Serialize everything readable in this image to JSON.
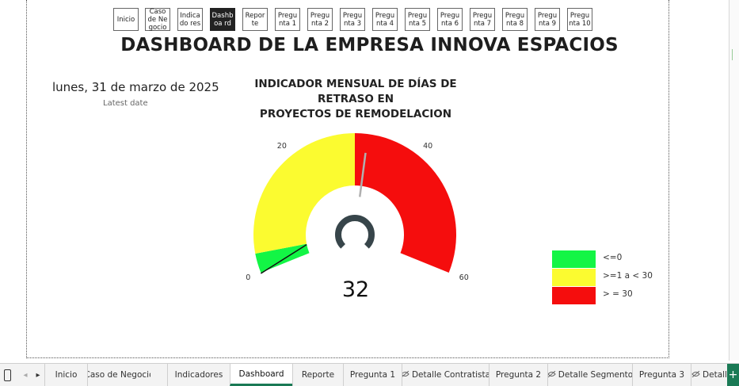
{
  "nav": {
    "buttons": [
      {
        "label": "Inicio"
      },
      {
        "label": "Caso de Negocio"
      },
      {
        "label": "Indicado res"
      },
      {
        "label": "Dashboa rd"
      },
      {
        "label": "Reporte"
      },
      {
        "label": "Pregunta 1"
      },
      {
        "label": "Pregunta 2"
      },
      {
        "label": "Pregunta 3"
      },
      {
        "label": "Pregunta 4"
      },
      {
        "label": "Pregunta 5"
      },
      {
        "label": "Pregunta 6"
      },
      {
        "label": "Pregunta 7"
      },
      {
        "label": "Pregunta 8"
      },
      {
        "label": "Pregunta 9"
      },
      {
        "label": "Pregunta 10"
      }
    ],
    "active_index": 3
  },
  "page": {
    "title": "DASHBOARD DE LA EMPRESA INNOVA ESPACIOS",
    "date": "lunes, 31 de marzo de 2025",
    "date_label": "Latest date"
  },
  "gauge": {
    "title_line1": "INDICADOR MENSUAL DE DÍAS DE RETRASO EN",
    "title_line2": "PROYECTOS DE REMODELACION",
    "min": 0,
    "max": 60,
    "value": 32,
    "value_text": "32",
    "ticks": [
      "0",
      "20",
      "40",
      "60"
    ],
    "bands": [
      {
        "from": 0,
        "to": 3,
        "color": "#13f545"
      },
      {
        "from": 3,
        "to": 30,
        "color": "#fbfb30"
      },
      {
        "from": 30,
        "to": 60,
        "color": "#f50d0d"
      }
    ],
    "needle_color": "#b0b0b0",
    "hub_color": "#37454a"
  },
  "legend": {
    "items": [
      {
        "label": "<=0",
        "color": "#13f545"
      },
      {
        "label": ">=1 a < 30",
        "color": "#fbfb30"
      },
      {
        "label": "> = 30",
        "color": "#f50d0d"
      }
    ]
  },
  "tabbar": {
    "tabs": [
      {
        "label": "Inicio",
        "hidden": false
      },
      {
        "label": "Caso de Negocio",
        "hidden": false
      },
      {
        "label": "Indicadores",
        "hidden": false
      },
      {
        "label": "Dashboard",
        "hidden": false
      },
      {
        "label": "Reporte",
        "hidden": false
      },
      {
        "label": "Pregunta 1",
        "hidden": false
      },
      {
        "label": "Detalle Contratista",
        "hidden": true
      },
      {
        "label": "Pregunta 2",
        "hidden": false
      },
      {
        "label": "Detalle Segmento",
        "hidden": true
      },
      {
        "label": "Pregunta 3",
        "hidden": false
      },
      {
        "label": "Detall",
        "hidden": true
      }
    ],
    "active_index": 3,
    "accent": "#1a7a55",
    "add_label": "+"
  }
}
